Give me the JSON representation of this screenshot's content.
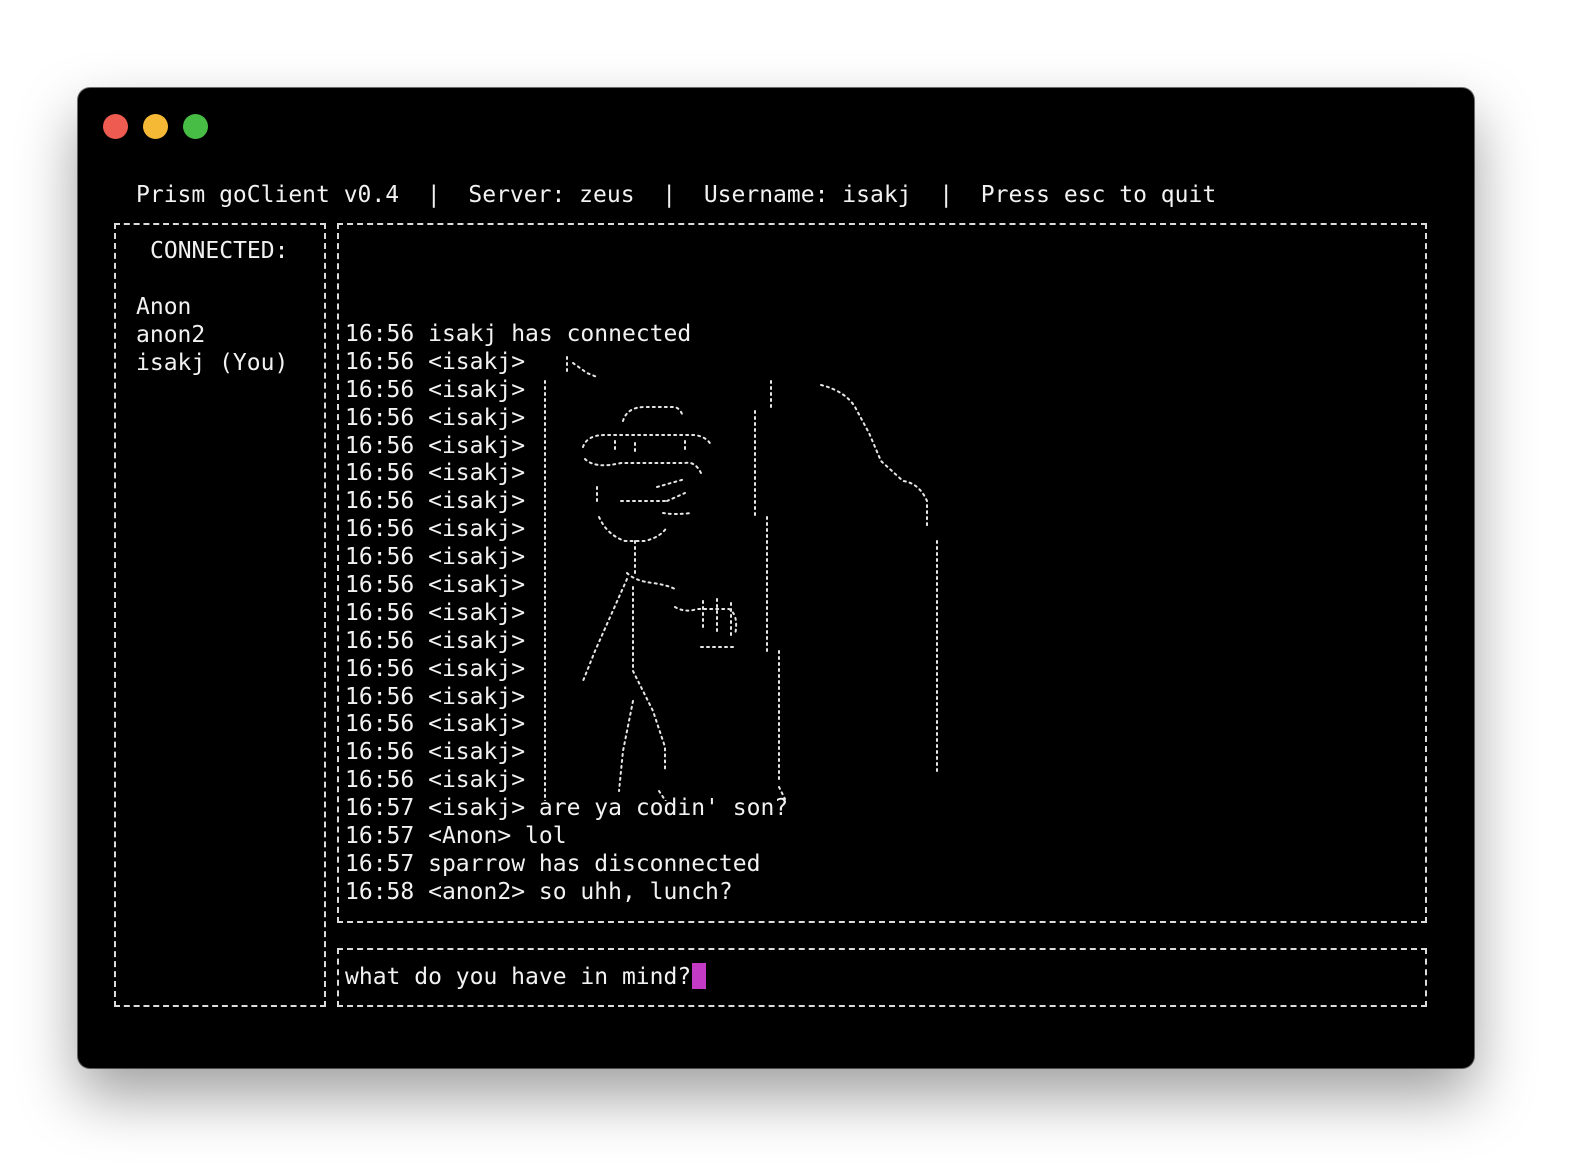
{
  "window_controls": {
    "close": "#ee5b51",
    "minimize": "#f5b935",
    "zoom": "#48bd45"
  },
  "header": {
    "app": "Prism goClient v0.4",
    "separator": "|",
    "server": "Server: zeus",
    "username": "Username: isakj",
    "hint": "Press esc to quit"
  },
  "users_panel": {
    "title": "CONNECTED:",
    "users": [
      "Anon",
      "anon2",
      "isakj (You)"
    ]
  },
  "messages": [
    {
      "time": "16:56",
      "text": "isakj has connected"
    },
    {
      "time": "16:56",
      "text": "<isakj>"
    },
    {
      "time": "16:56",
      "text": "<isakj>"
    },
    {
      "time": "16:56",
      "text": "<isakj>"
    },
    {
      "time": "16:56",
      "text": "<isakj>"
    },
    {
      "time": "16:56",
      "text": "<isakj>"
    },
    {
      "time": "16:56",
      "text": "<isakj>"
    },
    {
      "time": "16:56",
      "text": "<isakj>"
    },
    {
      "time": "16:56",
      "text": "<isakj>"
    },
    {
      "time": "16:56",
      "text": "<isakj>"
    },
    {
      "time": "16:56",
      "text": "<isakj>"
    },
    {
      "time": "16:56",
      "text": "<isakj>"
    },
    {
      "time": "16:56",
      "text": "<isakj>"
    },
    {
      "time": "16:56",
      "text": "<isakj>"
    },
    {
      "time": "16:56",
      "text": "<isakj>"
    },
    {
      "time": "16:56",
      "text": "<isakj>"
    },
    {
      "time": "16:56",
      "text": "<isakj>"
    },
    {
      "time": "16:57",
      "text": "<isakj> are ya codin' son?"
    },
    {
      "time": "16:57",
      "text": "<Anon> lol"
    },
    {
      "time": "16:57",
      "text": "sparrow has disconnected"
    },
    {
      "time": "16:58",
      "text": "<anon2> so uhh, lunch?"
    }
  ],
  "composer": {
    "value": "what do you have in mind?",
    "cursor_color": "#c33bc5"
  },
  "colors": {
    "terminal_background": "#000000",
    "text": "#f2f2f2",
    "border": "#dcdcdc"
  }
}
